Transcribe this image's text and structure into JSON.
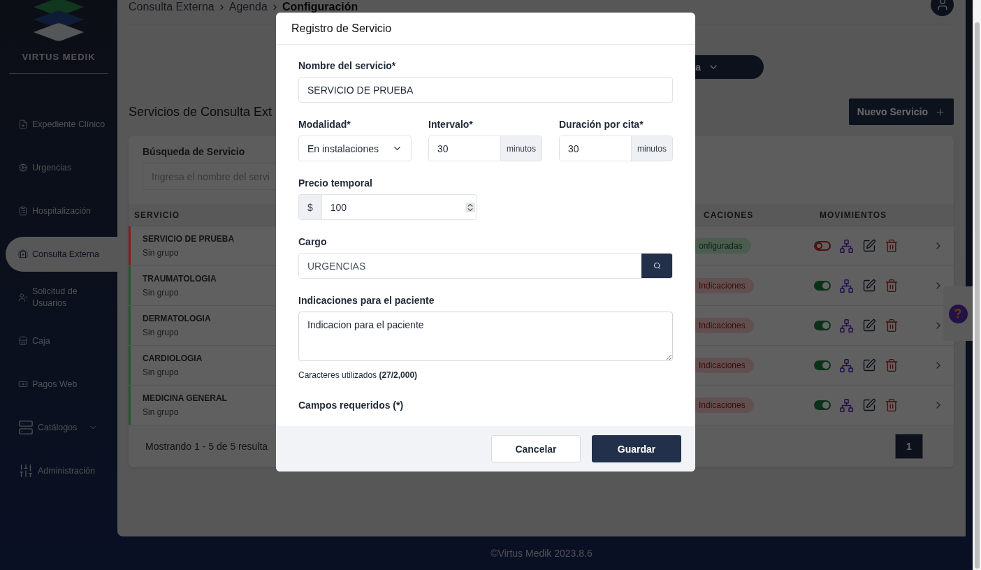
{
  "sidebar": {
    "brand": "VIRTUS MEDIK",
    "items": [
      {
        "label": "Expediente Clínico",
        "selected": false,
        "submenu": false
      },
      {
        "label": "Urgencias",
        "selected": false,
        "submenu": false
      },
      {
        "label": "Hospitalización",
        "selected": false,
        "submenu": false
      },
      {
        "label": "Consulta Externa",
        "selected": true,
        "submenu": false
      },
      {
        "label": "Solicitud de Usuarios",
        "selected": false,
        "submenu": false
      },
      {
        "label": "Caja",
        "selected": false,
        "submenu": false
      },
      {
        "label": "Pagos Web",
        "selected": false,
        "submenu": false
      },
      {
        "label": "Catálogos",
        "selected": false,
        "submenu": true
      },
      {
        "label": "Administración",
        "selected": false,
        "submenu": false
      }
    ]
  },
  "breadcrumb": [
    "Consulta Externa",
    "Agenda",
    "Configuración"
  ],
  "agenda_button": "a",
  "section_title": "Servicios de Consulta Ext",
  "new_button": "Nuevo Servicio",
  "search": {
    "label": "Búsqueda de Servicio",
    "placeholder": "Ingresa el nombre del servi"
  },
  "table": {
    "columns": [
      "SERVICIO",
      "CACIONES",
      "MOVIMIENTOS"
    ],
    "rows": [
      {
        "name": "SERVICIO DE PRUEBA",
        "group": "Sin grupo",
        "color": "#8b1a1a",
        "badge": "onfiguradas",
        "configured": true,
        "on": false
      },
      {
        "name": "TRAUMATOLOGIA",
        "group": "Sin grupo",
        "color": "#1d5a2e",
        "badge": "Indicaciones",
        "configured": false,
        "on": true
      },
      {
        "name": "DERMATOLOGIA",
        "group": "Sin grupo",
        "color": "#1d5a2e",
        "badge": "Indicaciones",
        "configured": false,
        "on": true
      },
      {
        "name": "CARDIOLOGIA",
        "group": "Sin grupo",
        "color": "#1d5a2e",
        "badge": "Indicaciones",
        "configured": false,
        "on": true
      },
      {
        "name": "MEDICINA GENERAL",
        "group": "Sin grupo",
        "color": "#1d5a2e",
        "badge": "Indicaciones",
        "configured": false,
        "on": true
      }
    ]
  },
  "pagination": {
    "summary": "Mostrando 1 - 5 de 5 resulta",
    "pages": [
      {
        "label": "1",
        "selected": true
      }
    ]
  },
  "footer": "©Virtus Medik 2023.8.6",
  "help_button": "?",
  "modal": {
    "title": "Registro de Servicio",
    "name": {
      "label": "Nombre del servicio*",
      "value": "SERVICIO DE PRUEBA"
    },
    "modality": {
      "label": "Modalidad*",
      "value": "En instalaciones"
    },
    "interval": {
      "label": "Intervalo*",
      "value": "30",
      "unit": "minutos"
    },
    "duration": {
      "label": "Duración por cita*",
      "value": "30",
      "unit": "minutos"
    },
    "price": {
      "label": "Precio temporal",
      "prefix": "$",
      "value": "100"
    },
    "charge": {
      "label": "Cargo",
      "value": "URGENCIAS"
    },
    "notes": {
      "label": "Indicaciones para el paciente",
      "value": "Indicacion para el paciente"
    },
    "char_count": "Caracteres utilizados **(27/2,000)**",
    "required_note": "Campos requeridos (*)",
    "buttons": [
      {
        "label": "Cancelar",
        "kind": "secondary"
      },
      {
        "label": "Guardar",
        "kind": "primary"
      }
    ]
  }
}
